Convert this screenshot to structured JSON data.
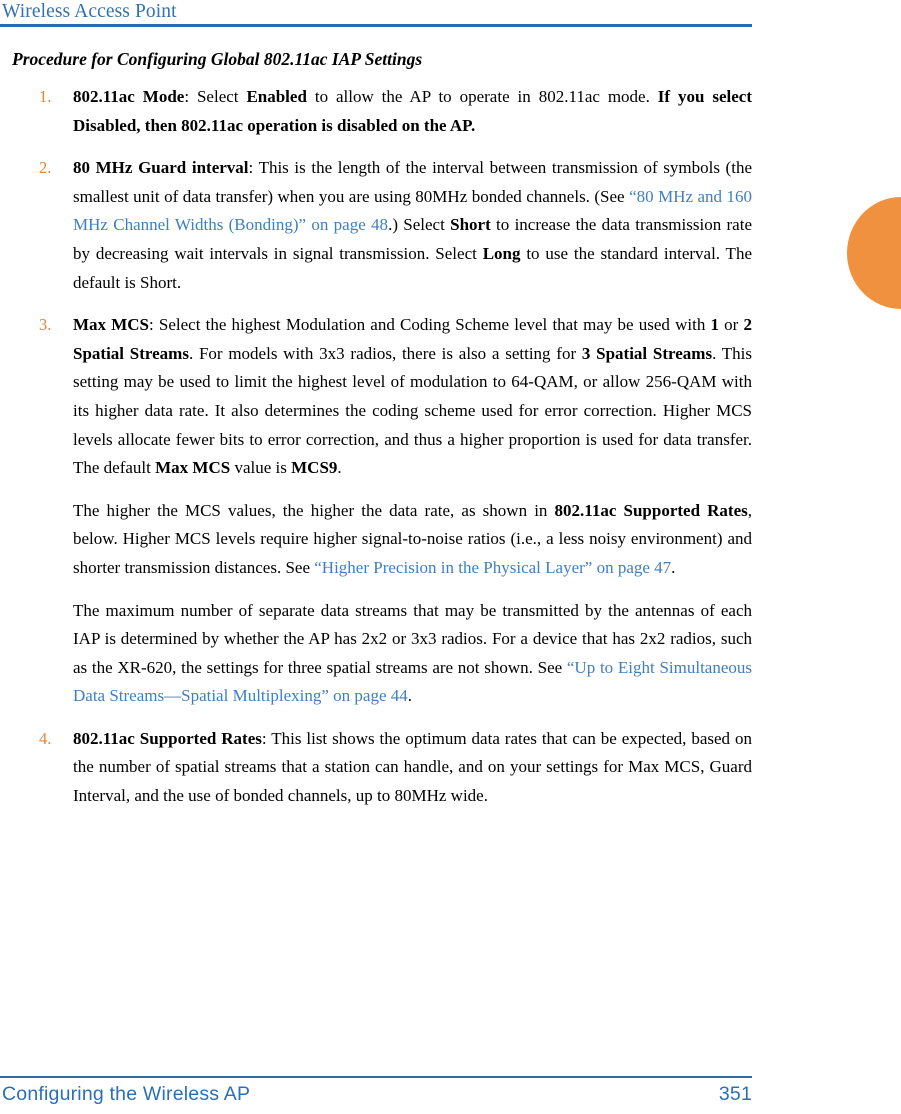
{
  "header": {
    "title": "Wireless Access Point",
    "rule_color": "#2a6cad"
  },
  "colors": {
    "header_blue": "#3471b0",
    "link_blue": "#3f7fc1",
    "list_number_orange": "#e8833a",
    "side_tab_orange": "#f0913f",
    "footer_blue": "#2a70b8",
    "body_text": "#000000"
  },
  "content": {
    "section_heading": "Procedure for Configuring Global 802.11ac IAP Settings",
    "items": [
      {
        "number": "1.",
        "paragraphs": [
          {
            "runs": [
              {
                "text": "802.11ac Mode",
                "style": "bold"
              },
              {
                "text": ": Select ",
                "style": "normal"
              },
              {
                "text": "Enabled",
                "style": "bold"
              },
              {
                "text": " to allow the AP to operate in 802.11ac mode. ",
                "style": "normal"
              },
              {
                "text": "If you select Disabled, then 802.11ac operation is disabled on the AP.",
                "style": "bold"
              }
            ]
          }
        ]
      },
      {
        "number": "2.",
        "paragraphs": [
          {
            "runs": [
              {
                "text": "80 MHz Guard interval",
                "style": "bold"
              },
              {
                "text": ": This is the length of the interval between transmission of symbols (the smallest unit of data transfer) when you are using 80MHz bonded channels. (See ",
                "style": "normal"
              },
              {
                "text": "“80 MHz and 160 MHz Channel Widths (Bonding)” on page 48",
                "style": "link"
              },
              {
                "text": ".) Select ",
                "style": "normal"
              },
              {
                "text": "Short",
                "style": "bold"
              },
              {
                "text": " to increase the data transmission rate by decreasing wait intervals in signal transmission. Select ",
                "style": "normal"
              },
              {
                "text": "Long",
                "style": "bold"
              },
              {
                "text": " to use the standard interval. The default is Short.",
                "style": "normal"
              }
            ]
          }
        ]
      },
      {
        "number": "3.",
        "paragraphs": [
          {
            "runs": [
              {
                "text": "Max MCS",
                "style": "bold"
              },
              {
                "text": ": Select the highest Modulation and Coding Scheme level that may be used with ",
                "style": "normal"
              },
              {
                "text": "1",
                "style": "bold"
              },
              {
                "text": " or ",
                "style": "normal"
              },
              {
                "text": "2 Spatial Streams",
                "style": "bold"
              },
              {
                "text": ". For models with 3x3 radios, there is also a setting for ",
                "style": "normal"
              },
              {
                "text": "3 Spatial Streams",
                "style": "bold"
              },
              {
                "text": ". This setting may be used to limit the highest level of modulation to 64-QAM, or allow 256-QAM with its higher data rate. It also determines the coding scheme used for error correction. Higher MCS levels allocate fewer bits to error correction, and thus a higher proportion is used for data transfer. The default ",
                "style": "normal"
              },
              {
                "text": "Max MCS",
                "style": "bold"
              },
              {
                "text": " value is ",
                "style": "normal"
              },
              {
                "text": "MCS9",
                "style": "bold"
              },
              {
                "text": ".",
                "style": "normal"
              }
            ]
          },
          {
            "runs": [
              {
                "text": "The higher the MCS values, the higher the data rate, as shown in ",
                "style": "normal"
              },
              {
                "text": "802.11ac Supported Rates",
                "style": "bold"
              },
              {
                "text": ", below. Higher MCS levels require higher signal-to-noise ratios (i.e., a less noisy environment) and shorter transmission distances. See ",
                "style": "normal"
              },
              {
                "text": "“Higher Precision in the Physical Layer” on page 47",
                "style": "link"
              },
              {
                "text": ".",
                "style": "normal"
              }
            ]
          },
          {
            "runs": [
              {
                "text": "The maximum number of separate data streams that may be transmitted by the antennas of each IAP is determined by whether the AP has 2x2 or 3x3 radios. For a device that has 2x2 radios, such as the XR-620, the settings for three spatial streams are not shown. See ",
                "style": "normal"
              },
              {
                "text": "“Up to Eight Simultaneous Data Streams—Spatial Multiplexing” on page 44",
                "style": "link"
              },
              {
                "text": ".",
                "style": "normal"
              }
            ]
          }
        ]
      },
      {
        "number": "4.",
        "paragraphs": [
          {
            "runs": [
              {
                "text": "802.11ac Supported Rates",
                "style": "bold"
              },
              {
                "text": ": This list shows the optimum data rates that can be expected, based on the number of spatial streams that a station can handle, and on your settings for Max MCS, Guard Interval, and the use of bonded channels, up to 80MHz wide.",
                "style": "normal"
              }
            ]
          }
        ]
      }
    ]
  },
  "footer": {
    "chapter_title": "Configuring the Wireless AP",
    "page_number": "351"
  },
  "side_tab": {
    "name": "chapter-thumb-tab"
  }
}
